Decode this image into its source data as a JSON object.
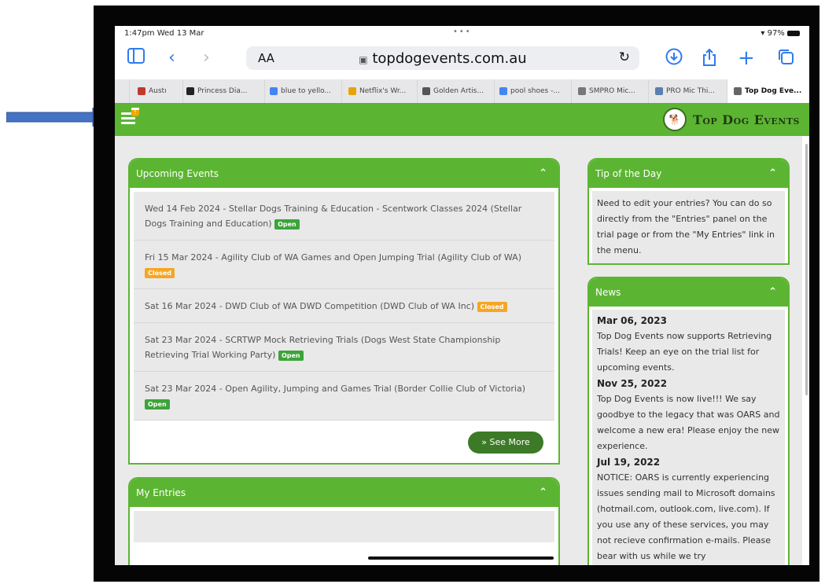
{
  "status": {
    "time": "1:47pm  Wed 13 Mar",
    "dots": "•••",
    "battery": "97%"
  },
  "browser": {
    "url": "topdogevents.com.au",
    "aa": "AA",
    "tabs": [
      {
        "label": "Austı",
        "color": "#c0392b"
      },
      {
        "label": "Princess Dia...",
        "color": "#222222"
      },
      {
        "label": "blue to yello...",
        "color": "#4285f4"
      },
      {
        "label": "Netflix's Wr...",
        "color": "#e5a50a"
      },
      {
        "label": "Golden Artis...",
        "color": "#555555"
      },
      {
        "label": "pool shoes -...",
        "color": "#4285f4"
      },
      {
        "label": "SMPRO Mic...",
        "color": "#777777"
      },
      {
        "label": "PRO Mic Thi...",
        "color": "#5a7fb0"
      },
      {
        "label": "Top Dog Eve...",
        "color": "#666666"
      }
    ]
  },
  "site": {
    "badge_count": "!",
    "logo_text": "Top Dog Events"
  },
  "upcoming": {
    "title": "Upcoming Events",
    "events": [
      {
        "text": "Wed 14 Feb 2024 - Stellar Dogs Training & Education - Scentwork Classes 2024 (Stellar Dogs Training and Education)",
        "status": "Open"
      },
      {
        "text": "Fri 15 Mar 2024 - Agility Club of WA Games and Open Jumping Trial (Agility Club of WA)",
        "status": "Closed"
      },
      {
        "text": "Sat 16 Mar 2024 - DWD Club of WA DWD Competition (DWD Club of WA Inc)",
        "status": "Closed"
      },
      {
        "text": "Sat 23 Mar 2024 - SCRTWP Mock Retrieving Trials (Dogs West State Championship Retrieving Trial Working Party)",
        "status": "Open"
      },
      {
        "text": "Sat 23 Mar 2024 - Open Agility, Jumping and Games Trial (Border Collie Club of Victoria)",
        "status": "Open"
      }
    ],
    "see_more": "See More"
  },
  "my_entries": {
    "title": "My Entries"
  },
  "tip": {
    "title": "Tip of the Day",
    "text": "Need to edit your entries? You can do so directly from the \"Entries\" panel on the trial page or from the \"My Entries\" link in the menu."
  },
  "news": {
    "title": "News",
    "items": [
      {
        "date": "Mar 06, 2023",
        "text": "Top Dog Events now supports Retrieving Trials! Keep an eye on the trial list for upcoming events."
      },
      {
        "date": "Nov 25, 2022",
        "text": "Top Dog Events is now live!!! We say goodbye to the legacy that was OARS and welcome a new era! Please enjoy the new experience."
      },
      {
        "date": "Jul 19, 2022",
        "text": "NOTICE: OARS is currently experiencing issues sending mail to Microsoft domains (hotmail.com, outlook.com, live.com). If you use any of these services, you may not recieve confirmation e-mails. Please bear with us while we try"
      }
    ]
  },
  "colors": {
    "green": "#5cb532",
    "open": "#3da33a",
    "closed": "#f5a623",
    "arrow": "#4472c4"
  }
}
